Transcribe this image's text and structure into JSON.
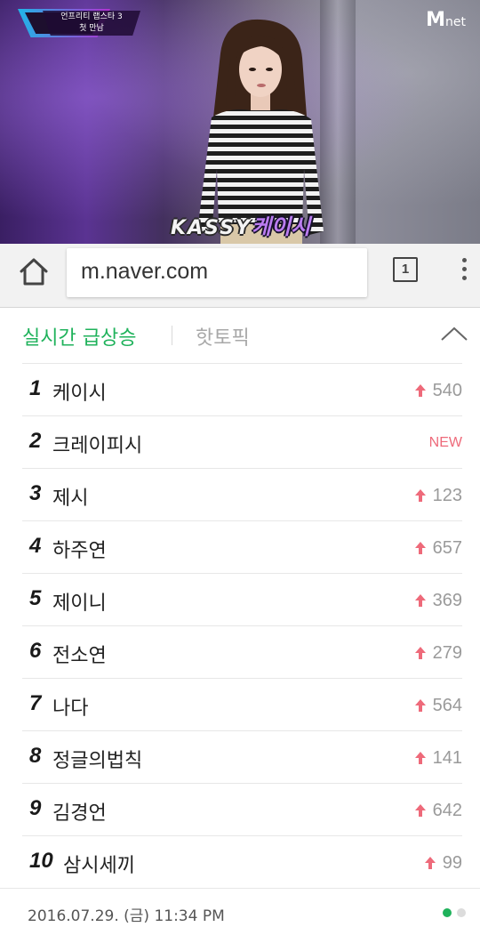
{
  "video": {
    "show_caption_line1": "언프리티 랩스타 3",
    "show_caption_line2": "첫 만남",
    "channel_logo": "M",
    "channel_logo_suffix": "net",
    "subtitle_en": "KASSY",
    "subtitle_ko": "케이시"
  },
  "browser": {
    "url": "m.naver.com",
    "tab_count": "1",
    "icons": [
      "home-icon",
      "tabs-icon",
      "more-vertical-icon"
    ]
  },
  "ranking": {
    "tab_active": "실시간 급상승",
    "tab_inactive": "핫토픽",
    "colors": {
      "accent_green": "#1fb25b",
      "up_red": "#ee6a7a",
      "new_red": "#ee6a7a"
    },
    "items": [
      {
        "rank": "1",
        "keyword": "케이시",
        "change": "540",
        "trend": "up"
      },
      {
        "rank": "2",
        "keyword": "크레이피시",
        "change": "NEW",
        "trend": "new"
      },
      {
        "rank": "3",
        "keyword": "제시",
        "change": "123",
        "trend": "up"
      },
      {
        "rank": "4",
        "keyword": "하주연",
        "change": "657",
        "trend": "up"
      },
      {
        "rank": "5",
        "keyword": "제이니",
        "change": "369",
        "trend": "up"
      },
      {
        "rank": "6",
        "keyword": "전소연",
        "change": "279",
        "trend": "up"
      },
      {
        "rank": "7",
        "keyword": "나다",
        "change": "564",
        "trend": "up"
      },
      {
        "rank": "8",
        "keyword": "정글의법칙",
        "change": "141",
        "trend": "up"
      },
      {
        "rank": "9",
        "keyword": "김경언",
        "change": "642",
        "trend": "up"
      },
      {
        "rank": "10",
        "keyword": "삼시세끼",
        "change": "99",
        "trend": "up"
      }
    ],
    "timestamp": "2016.07.29. (금) 11:34 PM",
    "page_dots": {
      "total": 2,
      "active": 1
    }
  }
}
